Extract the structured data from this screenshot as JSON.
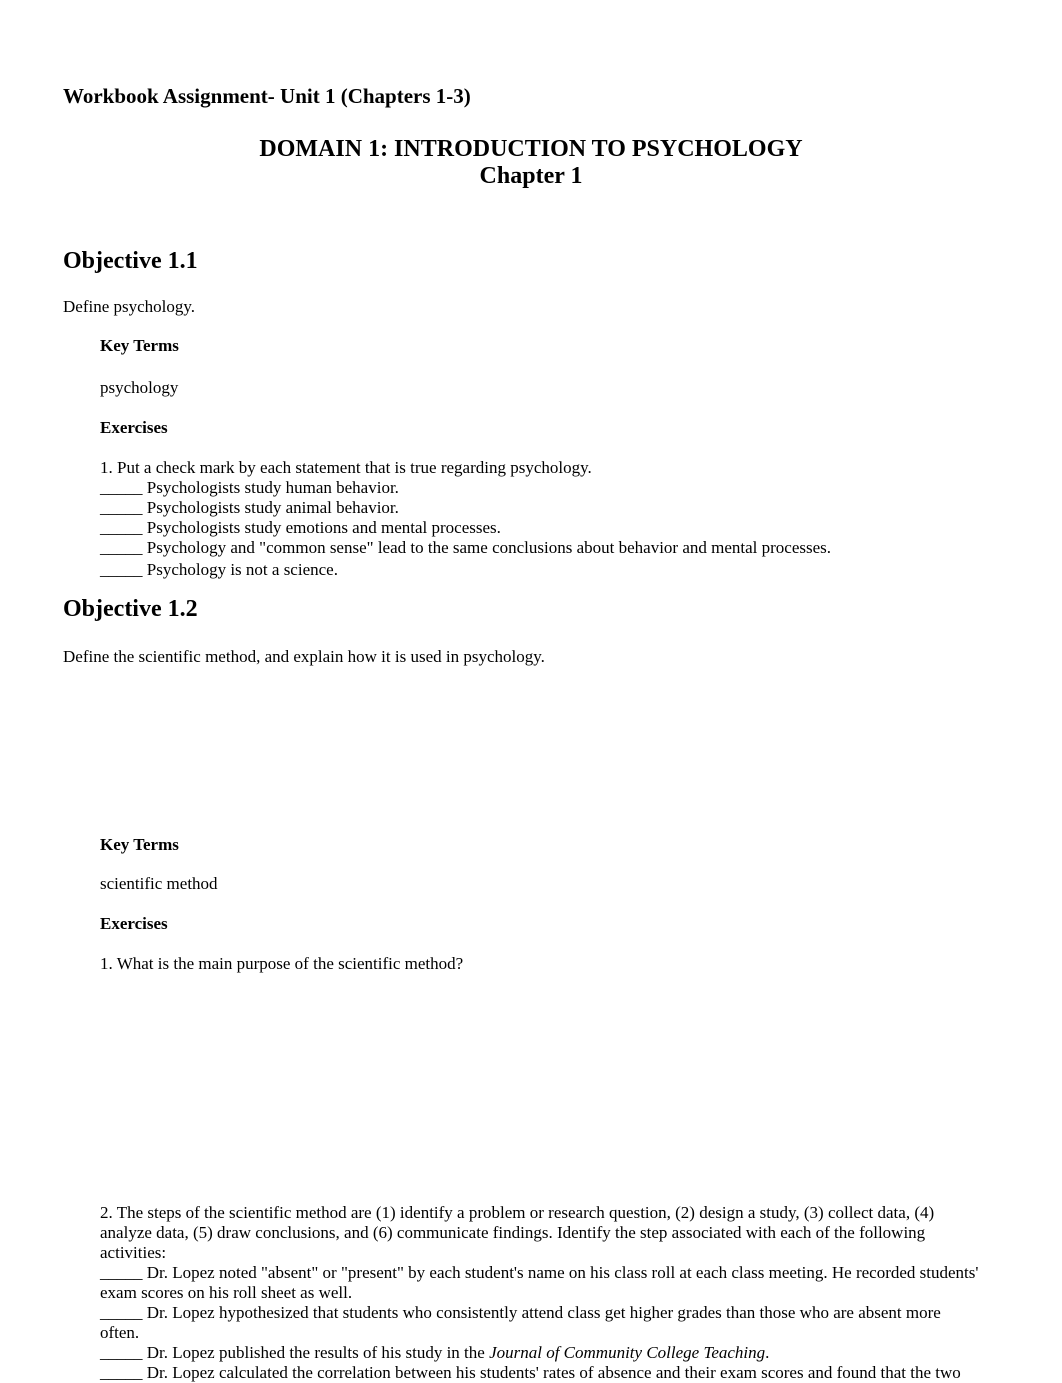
{
  "document": {
    "title": "Workbook Assignment- Unit 1 (Chapters 1-3)",
    "domain_heading": "DOMAIN 1: INTRODUCTION TO PSYCHOLOGY",
    "chapter_heading": "Chapter 1"
  },
  "objectives": [
    {
      "heading": "Objective 1.1",
      "description": "Define psychology.",
      "key_terms_label": "Key Terms",
      "key_terms": [
        "psychology"
      ],
      "exercises_label": "Exercises",
      "exercises": [
        {
          "prompt": "1. Put a check mark by each statement that is true regarding psychology.",
          "blank": "_____",
          "items": [
            "Psychologists study human behavior.",
            "Psychologists study animal behavior.",
            "Psychologists study emotions and mental processes.",
            "Psychology and \"common sense\" lead to the same conclusions about behavior and mental processes.",
            "Psychology is not a science."
          ]
        }
      ]
    },
    {
      "heading": "Objective 1.2",
      "description": "Define the scientific method, and explain how it is used in psychology.",
      "key_terms_label": "Key Terms",
      "key_terms": [
        "scientific method"
      ],
      "exercises_label": "Exercises",
      "exercises": [
        {
          "prompt": "1. What is the main purpose of the scientific method?"
        },
        {
          "prompt": "2. The steps of the scientific method are (1) identify a problem or research question, (2) design a study, (3) collect data, (4) analyze data, (5) draw conclusions, and (6) communicate findings.  Identify the step associated with each of the following activities:",
          "blank": "_____",
          "items": [
            "Dr. Lopez noted \"absent\" or \"present\" by each student's name on his class roll at each class meeting.  He recorded students' exam scores on his roll sheet as well.",
            "Dr. Lopez hypothesized that students who consistently attend class get higher grades than those who are absent more often.",
            "Dr. Lopez published the results of his study in the",
            "Dr. Lopez calculated the correlation between his students' rates of absence and their exam scores and found that the two"
          ],
          "journal_name": "Journal of Community College Teaching",
          "journal_suffix": "."
        }
      ]
    }
  ]
}
